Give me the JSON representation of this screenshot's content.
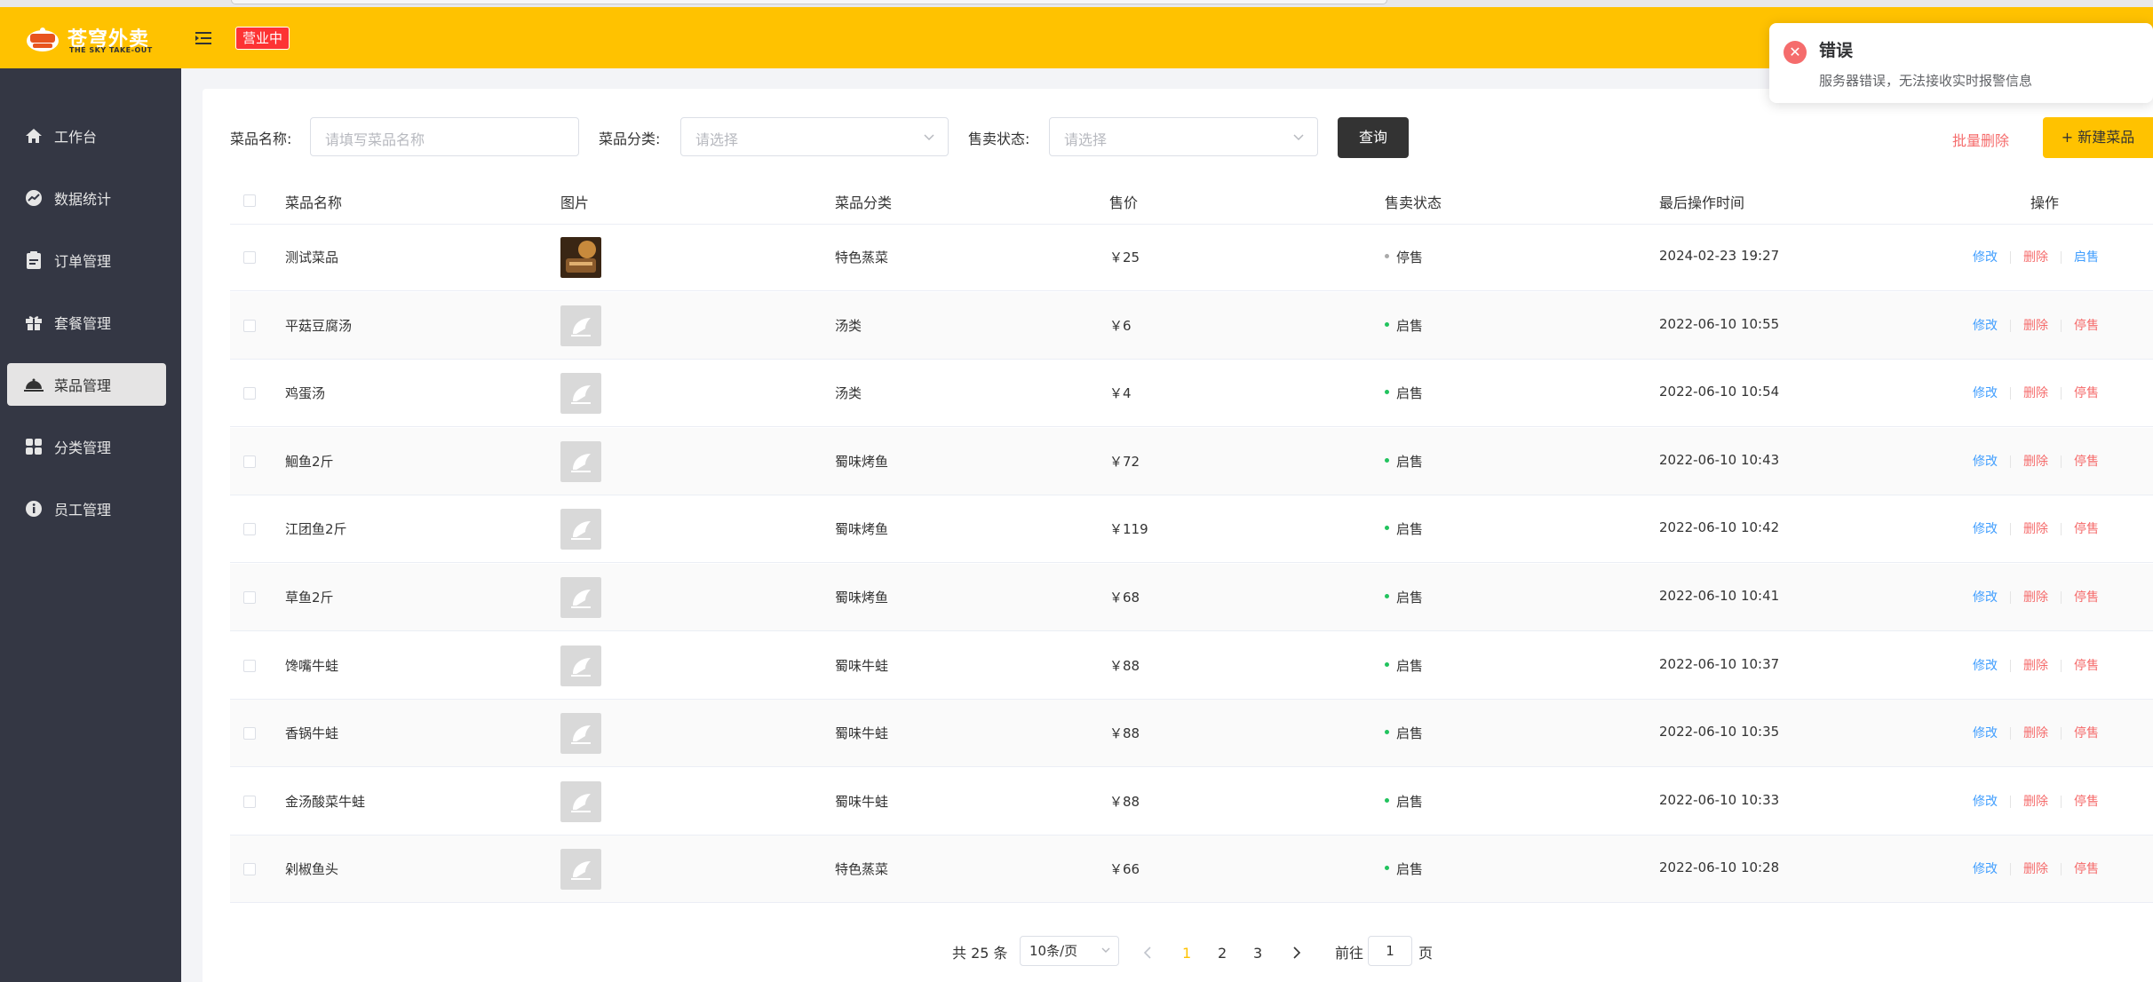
{
  "header": {
    "logo_text": "苍穹外卖",
    "logo_sub": "THE SKY TAKE-OUT",
    "status_badge": "营业中",
    "brand_color": "#ffc200"
  },
  "sidebar": {
    "items": [
      {
        "label": "工作台",
        "icon": "home-icon"
      },
      {
        "label": "数据统计",
        "icon": "chart-icon"
      },
      {
        "label": "订单管理",
        "icon": "clipboard-icon"
      },
      {
        "label": "套餐管理",
        "icon": "gift-icon"
      },
      {
        "label": "菜品管理",
        "icon": "dish-cover-icon",
        "active": true
      },
      {
        "label": "分类管理",
        "icon": "grid-icon"
      },
      {
        "label": "员工管理",
        "icon": "info-icon"
      }
    ]
  },
  "toast": {
    "title": "错误",
    "message": "服务器错误，无法接收实时报警信息"
  },
  "filters": {
    "name_label": "菜品名称:",
    "name_placeholder": "请填写菜品名称",
    "category_label": "菜品分类:",
    "category_placeholder": "请选择",
    "status_label": "售卖状态:",
    "status_placeholder": "请选择",
    "query_button": "查询",
    "batch_delete": "批量删除",
    "new_dish": "+ 新建菜品"
  },
  "table": {
    "headers": {
      "name": "菜品名称",
      "image": "图片",
      "category": "菜品分类",
      "price": "售价",
      "status": "售卖状态",
      "updated": "最后操作时间",
      "actions": "操作"
    },
    "action_labels": {
      "edit": "修改",
      "delete": "删除"
    },
    "rows": [
      {
        "name": "测试菜品",
        "category": "特色蒸菜",
        "price": "￥25",
        "status": "停售",
        "updated": "2024-02-23 19:27",
        "toggle": "启售",
        "photo": true
      },
      {
        "name": "平菇豆腐汤",
        "category": "汤类",
        "price": "￥6",
        "status": "启售",
        "updated": "2022-06-10 10:55",
        "toggle": "停售"
      },
      {
        "name": "鸡蛋汤",
        "category": "汤类",
        "price": "￥4",
        "status": "启售",
        "updated": "2022-06-10 10:54",
        "toggle": "停售"
      },
      {
        "name": "鮰鱼2斤",
        "category": "蜀味烤鱼",
        "price": "￥72",
        "status": "启售",
        "updated": "2022-06-10 10:43",
        "toggle": "停售"
      },
      {
        "name": "江团鱼2斤",
        "category": "蜀味烤鱼",
        "price": "￥119",
        "status": "启售",
        "updated": "2022-06-10 10:42",
        "toggle": "停售"
      },
      {
        "name": "草鱼2斤",
        "category": "蜀味烤鱼",
        "price": "￥68",
        "status": "启售",
        "updated": "2022-06-10 10:41",
        "toggle": "停售"
      },
      {
        "name": "馋嘴牛蛙",
        "category": "蜀味牛蛙",
        "price": "￥88",
        "status": "启售",
        "updated": "2022-06-10 10:37",
        "toggle": "停售"
      },
      {
        "name": "香锅牛蛙",
        "category": "蜀味牛蛙",
        "price": "￥88",
        "status": "启售",
        "updated": "2022-06-10 10:35",
        "toggle": "停售"
      },
      {
        "name": "金汤酸菜牛蛙",
        "category": "蜀味牛蛙",
        "price": "￥88",
        "status": "启售",
        "updated": "2022-06-10 10:33",
        "toggle": "停售"
      },
      {
        "name": "剁椒鱼头",
        "category": "特色蒸菜",
        "price": "￥66",
        "status": "启售",
        "updated": "2022-06-10 10:28",
        "toggle": "停售"
      }
    ]
  },
  "pagination": {
    "total": "共 25 条",
    "page_size": "10条/页",
    "pages": [
      "1",
      "2",
      "3"
    ],
    "current": "1",
    "goto_prefix": "前往",
    "goto_value": "1",
    "goto_suffix": "页"
  }
}
